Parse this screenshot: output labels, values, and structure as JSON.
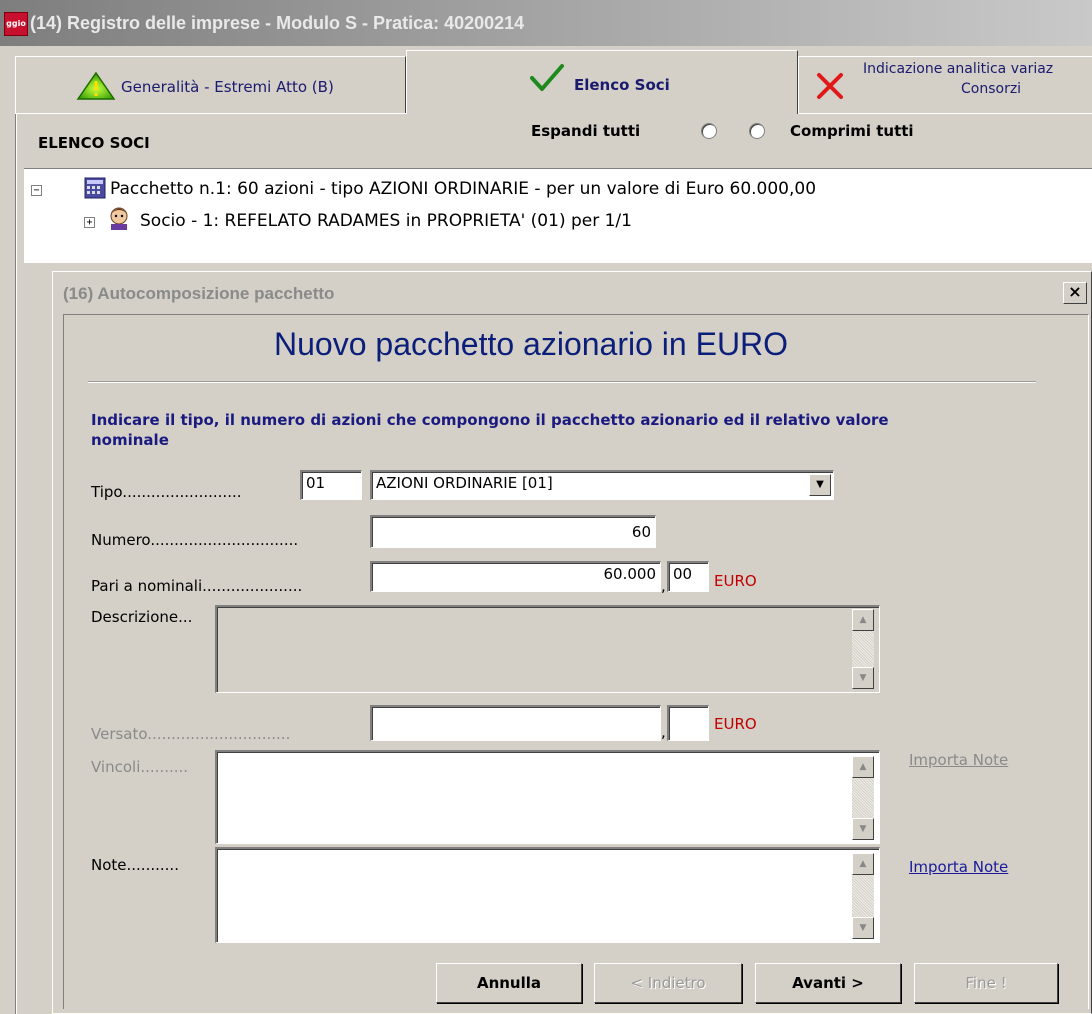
{
  "window": {
    "title": "(14) Registro delle imprese - Modulo S - Pratica: 40200214",
    "app_icon_text": "ggio"
  },
  "tabs": [
    {
      "label": "Generalità - Estremi Atto (B)",
      "state": "warning"
    },
    {
      "label": "Elenco Soci",
      "state": "ok"
    },
    {
      "label_line1": "Indicazione analitica variaz",
      "label_line2": "Consorzi",
      "state": "error"
    }
  ],
  "section": {
    "title": "ELENCO SOCI",
    "expand_label": "Espandi tutti",
    "collapse_label": "Comprimi tutti"
  },
  "tree": {
    "packet": "Pacchetto n.1: 60 azioni - tipo AZIONI ORDINARIE - per un valore di Euro 60.000,00",
    "member": "Socio - 1: REFELATO RADAMES in PROPRIETA' (01) per 1/1"
  },
  "dialog": {
    "title": "(16) Autocomposizione pacchetto",
    "close": "×",
    "heading": "Nuovo pacchetto azionario in EURO",
    "instructions": "Indicare il tipo, il numero di azioni che compongono il pacchetto azionario ed il relativo valore nominale",
    "fields": {
      "tipo_label": "Tipo.........................",
      "tipo_code": "01",
      "tipo_value": "AZIONI ORDINARIE [01]",
      "numero_label": "Numero...............................",
      "numero_value": "60",
      "nominali_label": "Pari a  nominali.....................",
      "nominali_int": "60.000",
      "nominali_dec": "00",
      "currency": "EURO",
      "descrizione_label": "Descrizione...",
      "versato_label": "Versato..............................",
      "vincoli_label": "Vincoli..........",
      "note_label": "Note...........",
      "import_notes": "Importa Note",
      "comma": ","
    },
    "buttons": {
      "cancel": "Annulla",
      "back": "< Indietro",
      "next": "Avanti >",
      "finish": "Fine !"
    }
  }
}
